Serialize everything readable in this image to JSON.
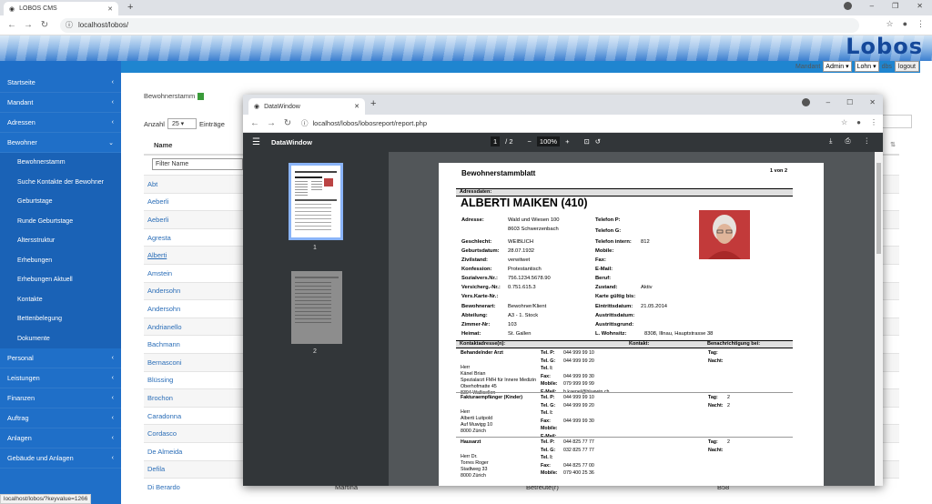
{
  "browser": {
    "tab_title": "LOBOS CMS",
    "url": "localhost/lobos/"
  },
  "header": {
    "logo": "Lobos",
    "mandant_label": "Mandant",
    "mandant_value": "Admin ▾",
    "lohn_value": "Lohn ▾",
    "dbs": "dbs",
    "logout": "logout"
  },
  "sidebar": {
    "items": [
      {
        "label": "Startseite",
        "chev": "‹"
      },
      {
        "label": "Mandant",
        "chev": "‹"
      },
      {
        "label": "Adressen",
        "chev": "‹"
      },
      {
        "label": "Bewohner",
        "chev": "⌄"
      }
    ],
    "sub": [
      "Bewohnerstamm",
      "Suche Kontakte der Bewohner",
      "Geburtstage",
      "Runde Geburtstage",
      "Altersstruktur",
      "Erhebungen",
      "Erhebungen Aktuell",
      "Kontakte",
      "Bettenbelegung",
      "Dokumente"
    ],
    "items2": [
      "Personal",
      "Leistungen",
      "Finanzen",
      "Auftrag",
      "Anlagen",
      "Gebäude und Anlagen"
    ]
  },
  "main": {
    "title": "Bewohnerstamm",
    "anzahl": "Anzahl",
    "len": "25 ▾",
    "eintraege": "Einträge",
    "col_name": "Name",
    "filter_placeholder": "Filter Name",
    "rows": [
      "Abt",
      "Aeberli",
      "Aeberli",
      "Agresta",
      "Alberti",
      "Amstein",
      "Andersohn",
      "Andersohn",
      "Andrianello",
      "Bachmann",
      "Bernasconi",
      "Blüssing",
      "Brochon",
      "Caradonna",
      "Cordasco",
      "De Almeida",
      "Defila",
      "Di Berardo"
    ],
    "last_row": {
      "c2": "Martina",
      "c3": "Betreute(r)",
      "c4": "B58"
    }
  },
  "status_url": "localhost/lobos/?keyvalue=1266",
  "popup": {
    "tab_title": "DataWindow",
    "url": "localhost/lobos/lobosreport/report.php",
    "viewer_title": "DataWindow",
    "page_current": "1",
    "page_total": "/ 2",
    "zoom": "100%",
    "thumb1": "1",
    "thumb2": "2"
  },
  "doc": {
    "title": "Bewohnerstammblatt",
    "page": "1 von 2",
    "section1": "Adressdaten:",
    "name": "ALBERTI MAIKEN (410)",
    "left": [
      [
        "Adresse:",
        "Wald und Wiesen 100"
      ],
      [
        "",
        "8603 Schwerzenbach"
      ],
      [
        "Geschlecht:",
        "WEIBLICH"
      ],
      [
        "Geburtsdatum:",
        "28.07.1932"
      ],
      [
        "Zivilstand:",
        "verwitwet"
      ],
      [
        "Konfession:",
        "Protestantisch"
      ],
      [
        "Sozialvers.Nr.:",
        "756.1234.5678.90"
      ],
      [
        "Versicherg.-Nr.:",
        "0.751.615.3"
      ],
      [
        "Vers.Karte-Nr.:",
        ""
      ],
      [
        "Bewohnerart:",
        "Bewohner/Klient"
      ],
      [
        "Abteilung:",
        "A3 - 1. Stock"
      ],
      [
        "Zimmer-Nr:",
        "103"
      ],
      [
        "Heimat:",
        "St. Gallen"
      ]
    ],
    "right": [
      [
        "Telefon P:",
        ""
      ],
      [
        "Telefon G:",
        ""
      ],
      [
        "Telefon intern:",
        "812"
      ],
      [
        "Mobile:",
        ""
      ],
      [
        "Fax:",
        ""
      ],
      [
        "E-Mail:",
        ""
      ],
      [
        "Beruf:",
        ""
      ],
      [
        "Zustand:",
        "Aktiv"
      ],
      [
        "Karte gültig bis:",
        ""
      ],
      [
        "Eintrittsdatum:",
        "21.05.2014"
      ],
      [
        "Austrittsdatum:",
        ""
      ],
      [
        "Austrittsgrund:",
        ""
      ],
      [
        "L. Wohnsitz:",
        "8308, Illnau, Hauptstrasse 38"
      ]
    ],
    "contacts_header": {
      "a": "Kontaktadresse(n):",
      "b": "Kontakt:",
      "c": "Benachrichtigung bei:"
    },
    "contacts": [
      {
        "role": "Behandelnder Arzt",
        "lines": [
          "Herr",
          "Känel Brian",
          "Spezialarzt FMH für Innere Medizin",
          "Oberhofmatte 45",
          "8304 Wallisellen"
        ],
        "kontakt": [
          [
            "Tel. P:",
            "044 999 99 10"
          ],
          [
            "Tel. G:",
            "044 999 99 20"
          ],
          [
            "Tel. I:",
            ""
          ],
          [
            "Fax:",
            "044 999 99 30"
          ],
          [
            "Mobile:",
            "079 999 99 99"
          ],
          [
            "E-Mail:",
            "b.kaenel@bluewin.ch"
          ]
        ],
        "notif": [
          [
            "Tag:",
            ""
          ],
          [
            "Nacht:",
            ""
          ]
        ]
      },
      {
        "role": "Fakturaempfänger (Kinder)",
        "lines": [
          "Herr",
          "Alberti Luitpold",
          "Auf Muwigg 10",
          "8000 Zürich"
        ],
        "kontakt": [
          [
            "Tel. P:",
            "044 999 99 10"
          ],
          [
            "Tel. G:",
            "044 999 99 20"
          ],
          [
            "Tel. I:",
            ""
          ],
          [
            "Fax:",
            "044 999 99 30"
          ],
          [
            "Mobile:",
            ""
          ],
          [
            "E-Mail:",
            ""
          ]
        ],
        "notif": [
          [
            "Tag:",
            "2"
          ],
          [
            "Nacht:",
            "2"
          ]
        ]
      },
      {
        "role": "Hausarzt",
        "lines": [
          "Herr Dr.",
          "Torres Roger",
          "Stadtweg 33",
          "8000 Zürich"
        ],
        "kontakt": [
          [
            "Tel. P:",
            "044 825 77 77"
          ],
          [
            "Tel. G:",
            "032 825 77 77"
          ],
          [
            "Tel. I:",
            ""
          ],
          [
            "Fax:",
            "044 825 77 00"
          ],
          [
            "Mobile:",
            "079 400 25 36"
          ]
        ],
        "notif": [
          [
            "Tag:",
            "2"
          ],
          [
            "Nacht:",
            ""
          ]
        ]
      }
    ]
  }
}
